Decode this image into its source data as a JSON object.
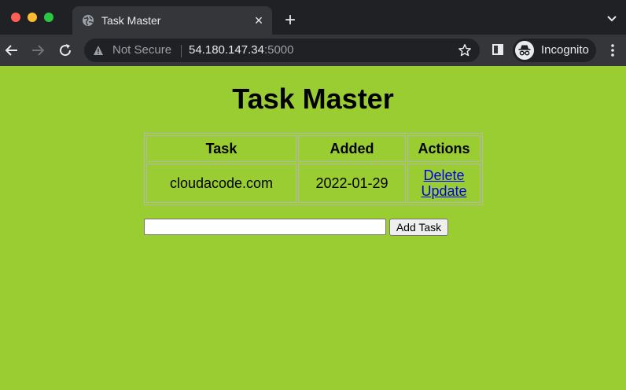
{
  "browser": {
    "tab_title": "Task Master",
    "security_label": "Not Secure",
    "url_host": "54.180.147.34",
    "url_port": ":5000",
    "profile_label": "Incognito"
  },
  "page": {
    "title": "Task Master",
    "table": {
      "headers": [
        "Task",
        "Added",
        "Actions"
      ],
      "rows": [
        {
          "task": "cloudacode.com",
          "added": "2022-01-29",
          "actions": [
            "Delete",
            "Update"
          ]
        }
      ]
    },
    "form": {
      "input_value": "",
      "submit_label": "Add Task"
    }
  },
  "colors": {
    "page_background": "#9acd32",
    "link": "#0000ee",
    "browser_chrome": "#202124",
    "toolbar": "#35363a"
  }
}
